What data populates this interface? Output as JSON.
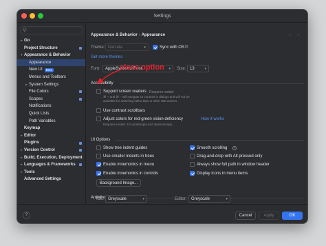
{
  "window": {
    "title": "Settings"
  },
  "sidebar": {
    "search_placeholder": "Q-",
    "items": [
      {
        "label": "Go",
        "arrow": "▸",
        "bold": true,
        "indent": 0
      },
      {
        "label": "Project Structure",
        "arrow": "",
        "bold": true,
        "indent": 0,
        "marker": true
      },
      {
        "label": "Appearance & Behavior",
        "arrow": "▾",
        "bold": true,
        "indent": 0
      },
      {
        "label": "Appearance",
        "arrow": "",
        "bold": false,
        "indent": 1,
        "selected": true
      },
      {
        "label": "New UI",
        "arrow": "",
        "bold": false,
        "indent": 1,
        "badge": "Beta"
      },
      {
        "label": "Menus and Toolbars",
        "arrow": "",
        "bold": false,
        "indent": 1
      },
      {
        "label": "System Settings",
        "arrow": "▸",
        "bold": false,
        "indent": 1
      },
      {
        "label": "File Colors",
        "arrow": "",
        "bold": false,
        "indent": 1,
        "marker": true
      },
      {
        "label": "Scopes",
        "arrow": "",
        "bold": false,
        "indent": 1,
        "marker": true
      },
      {
        "label": "Notifications",
        "arrow": "",
        "bold": false,
        "indent": 1
      },
      {
        "label": "Quick Lists",
        "arrow": "",
        "bold": false,
        "indent": 1
      },
      {
        "label": "Path Variables",
        "arrow": "",
        "bold": false,
        "indent": 1
      },
      {
        "label": "Keymap",
        "arrow": "",
        "bold": true,
        "indent": 0
      },
      {
        "label": "Editor",
        "arrow": "▸",
        "bold": true,
        "indent": 0
      },
      {
        "label": "Plugins",
        "arrow": "",
        "bold": true,
        "indent": 0,
        "marker": true
      },
      {
        "label": "Version Control",
        "arrow": "▸",
        "bold": true,
        "indent": 0,
        "marker": true
      },
      {
        "label": "Build, Execution, Deployment",
        "arrow": "▸",
        "bold": true,
        "indent": 0
      },
      {
        "label": "Languages & Frameworks",
        "arrow": "▸",
        "bold": true,
        "indent": 0,
        "marker": true
      },
      {
        "label": "Tools",
        "arrow": "▸",
        "bold": true,
        "indent": 0
      },
      {
        "label": "Advanced Settings",
        "arrow": "",
        "bold": true,
        "indent": 0
      }
    ]
  },
  "breadcrumb": {
    "parent": "Appearance & Behavior",
    "separator": "›",
    "current": "Appearance"
  },
  "nav": {
    "back": "←",
    "forward": "→"
  },
  "theme": {
    "label": "Theme:",
    "value": "Darcula",
    "sync_label": "Sync with OS",
    "sync_checked": true
  },
  "get_more_themes": "Get more themes",
  "font": {
    "label": "Font:",
    "value": "AppleSystemUIFont",
    "size_label": "Size:",
    "size_value": "13"
  },
  "accessibility": {
    "header": "Accessibility",
    "screen_readers_label": "Support screen readers",
    "screen_readers_note": "Requires restart",
    "screen_readers_hint_1": "⌘ + and ⌘ − will navigate UI controls in dialogs and will not be",
    "screen_readers_hint_2": "available for switching editor tabs or other IDE actions",
    "contrast_scrollbars_label": "Use contrast scrollbars",
    "redgreen_label": "Adjust colors for red-green vision deficiency",
    "redgreen_link": "How it works",
    "redgreen_hint": "Requires restart. For protanopia and deuteranopia."
  },
  "ui_options": {
    "header": "UI Options",
    "left": [
      {
        "label": "Show tree indent guides",
        "checked": false
      },
      {
        "label": "Use smaller indents in trees",
        "checked": false
      },
      {
        "label": "Enable mnemonics in menu",
        "checked": true
      },
      {
        "label": "Enable mnemonics in controls",
        "checked": true
      }
    ],
    "right": [
      {
        "label": "Smooth scrolling",
        "checked": true,
        "info": true
      },
      {
        "label": "Drag-and-drop with Alt pressed only",
        "checked": false
      },
      {
        "label": "Always show full path in window header",
        "checked": false
      },
      {
        "label": "Display icons in menu items",
        "checked": true
      }
    ],
    "background_button": "Background Image..."
  },
  "antialiasing": {
    "header": "Antialiasing",
    "ide_label": "IDE:",
    "ide_value": "Greyscale",
    "editor_label": "Editor:",
    "editor_value": "Greyscale"
  },
  "footer": {
    "help": "?",
    "cancel": "Cancel",
    "apply": "Apply",
    "ok": "OK"
  },
  "annotation": {
    "text": "close option",
    "color": "#e8202a"
  },
  "colors": {
    "accent": "#3574f0",
    "selection": "#2e436e",
    "link": "#5a8fe8",
    "background": "#2b2d30"
  }
}
